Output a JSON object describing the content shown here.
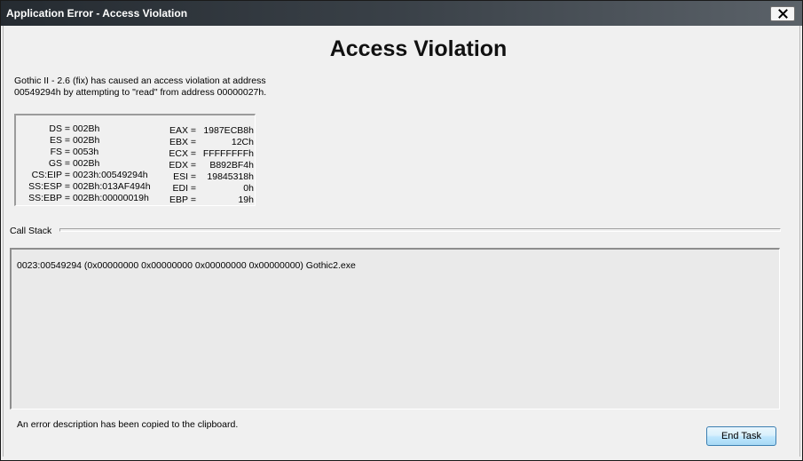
{
  "window": {
    "title": "Application Error - Access Violation"
  },
  "icons": {
    "close": "close-icon"
  },
  "heading": "Access Violation",
  "description": "Gothic II - 2.6 (fix) has caused an access violation at address 00549294h by attempting to \"read\" from address 00000027h.",
  "registers": {
    "segment": [
      {
        "name": "DS",
        "value": "002Bh"
      },
      {
        "name": "ES",
        "value": "002Bh"
      },
      {
        "name": "FS",
        "value": "0053h"
      },
      {
        "name": "GS",
        "value": "002Bh"
      },
      {
        "name": "CS:EIP",
        "value": "0023h:00549294h"
      },
      {
        "name": "SS:ESP",
        "value": "002Bh:013AF494h"
      },
      {
        "name": "SS:EBP",
        "value": "002Bh:00000019h"
      }
    ],
    "general": [
      {
        "name": "EAX",
        "value": "1987ECB8h"
      },
      {
        "name": "EBX",
        "value": "12Ch"
      },
      {
        "name": "ECX",
        "value": "FFFFFFFFh"
      },
      {
        "name": "EDX",
        "value": "B892BF4h"
      },
      {
        "name": "ESI",
        "value": "19845318h"
      },
      {
        "name": "EDI",
        "value": "0h"
      },
      {
        "name": "EBP",
        "value": "19h"
      }
    ]
  },
  "call_stack": {
    "label": "Call Stack",
    "lines": [
      "0023:00549294 (0x00000000 0x00000000 0x00000000 0x00000000) Gothic2.exe"
    ]
  },
  "status": {
    "clipboard_message": "An error description has been copied to the clipboard."
  },
  "buttons": {
    "end_task": "End Task"
  }
}
